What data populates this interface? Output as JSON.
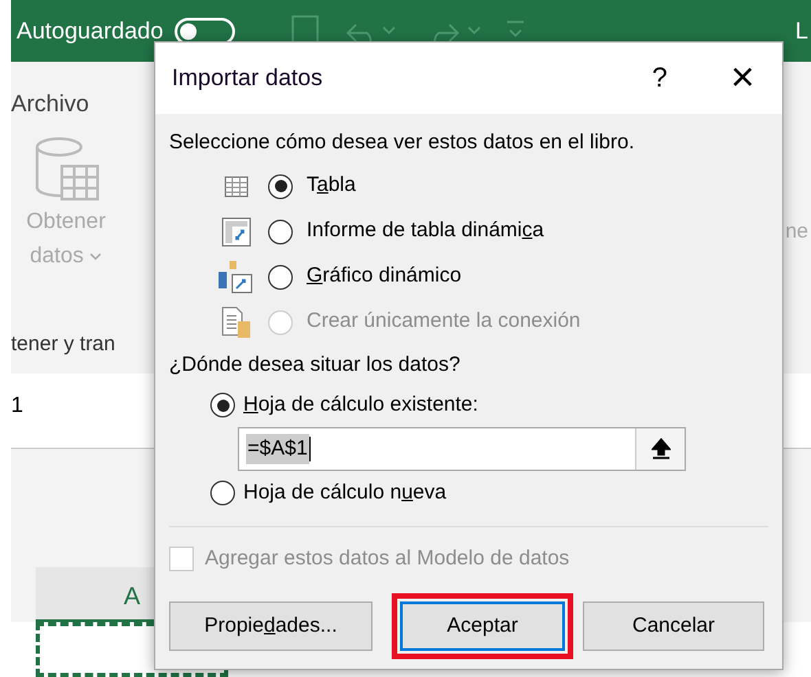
{
  "app": {
    "autosave_label": "Autoguardado",
    "autosave_on": false,
    "title_fragment": "L",
    "ribbon_tab": "Archivo",
    "ribbon_button_lines": [
      "Obtener",
      "datos"
    ],
    "ribbon_right_fragment": "ne",
    "group_label": "tener y tran",
    "name_box": "1",
    "column_header": "A"
  },
  "dialog": {
    "title": "Importar datos",
    "help": "?",
    "close": "×",
    "prompt": "Seleccione cómo desea ver estos datos en el libro.",
    "view_options": [
      {
        "kind": "table",
        "label": {
          "before": "T",
          "key": "a",
          "after": "bla"
        },
        "selected": true,
        "disabled": false
      },
      {
        "kind": "pivot",
        "label": {
          "before": "Informe de tabla dinámi",
          "key": "c",
          "after": "a"
        },
        "selected": false,
        "disabled": false
      },
      {
        "kind": "chart",
        "label": {
          "key": "G",
          "after": "ráfico dinámico"
        },
        "selected": false,
        "disabled": false
      },
      {
        "kind": "connection",
        "label": {
          "before": "Crear únicamente la conexión"
        },
        "selected": false,
        "disabled": true
      }
    ],
    "location_prompt": "¿Dónde desea situar los datos?",
    "location_options": [
      {
        "label": {
          "key": "H",
          "after": "oja de cálculo existente:"
        },
        "selected": true
      },
      {
        "label": {
          "before": "Hoja de cálculo n",
          "key": "u",
          "after": "eva"
        },
        "selected": false
      }
    ],
    "range_value": "=$A$1",
    "model_checkbox": {
      "label": "Agregar estos datos al Modelo de datos",
      "checked": false,
      "disabled": true
    },
    "buttons": [
      {
        "label": {
          "before": "Propie",
          "key": "d",
          "after": "ades..."
        },
        "default": false,
        "highlighted": false
      },
      {
        "label": {
          "before": "Aceptar"
        },
        "default": true,
        "highlighted": true
      },
      {
        "label": {
          "before": "Cancelar"
        },
        "default": false,
        "highlighted": false
      }
    ]
  }
}
